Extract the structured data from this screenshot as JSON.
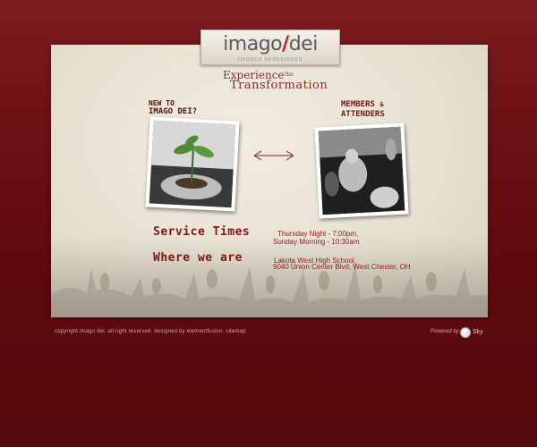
{
  "logo": {
    "main_left": "imago",
    "main_right": "dei",
    "tagline": "CHURCH REDESIGNED"
  },
  "headline": {
    "experience": "Experience",
    "the": "the",
    "transformation": "Transformation"
  },
  "new_visitors": {
    "line1": "NEW TO",
    "line2": "IMAGO DEI?"
  },
  "members": {
    "line1": "MEMBERS",
    "amp": "&",
    "line2": "ATTENDERS"
  },
  "service": {
    "title": "Service Times",
    "line1": "Thursday Night - 7:00pm,",
    "line2": "Sunday Morning - 10:30am"
  },
  "location": {
    "title": "Where we are",
    "line1": "Lakota West High School,",
    "line2": "9040 Union Center Blvd, West Chester, OH"
  },
  "footer": {
    "copyright": "copyright imago dei. all right reserved. designed by elementfusion. sitemap",
    "powered_by": "Powered by",
    "brand": "Sky"
  },
  "colors": {
    "background": "#6f1216",
    "paper": "#ece7da",
    "accent": "#c4141c",
    "heading": "#7a1a16"
  },
  "icons": {
    "arrow": "double-arrow-icon",
    "sky": "sky-logo-icon"
  }
}
